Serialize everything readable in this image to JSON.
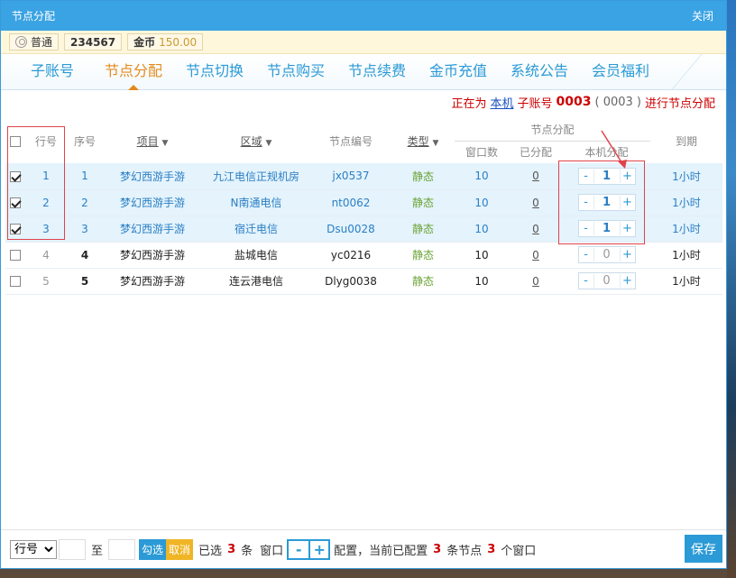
{
  "window": {
    "title": "节点分配",
    "close_label": "关闭"
  },
  "user": {
    "level": "普通",
    "id": "234567",
    "coin_label": "金币",
    "coin_value": "150.00"
  },
  "tabs": [
    {
      "label": "子账号"
    },
    {
      "label": "节点分配"
    },
    {
      "label": "节点切换"
    },
    {
      "label": "节点购买"
    },
    {
      "label": "节点续费"
    },
    {
      "label": "金币充值"
    },
    {
      "label": "系统公告"
    },
    {
      "label": "会员福利"
    }
  ],
  "info": {
    "prefix": "正在为",
    "link": "本机",
    "mid": "子账号",
    "account": "0003",
    "paren": "( 0003 )",
    "suffix": "进行节点分配"
  },
  "table": {
    "headers": {
      "row_no": "行号",
      "seq": "序号",
      "project": "项目",
      "region": "区域",
      "node_id": "节点编号",
      "type": "类型",
      "node_alloc": "节点分配",
      "win_count": "窗口数",
      "allocated": "已分配",
      "local_alloc": "本机分配",
      "expire": "到期"
    },
    "rows": [
      {
        "checked": true,
        "row_no": "1",
        "seq": "1",
        "project": "梦幻西游手游",
        "region": "九江电信正规机房",
        "node_id": "jx0537",
        "type": "静态",
        "win_count": "10",
        "allocated": "0",
        "local": "1",
        "expire": "1小时"
      },
      {
        "checked": true,
        "row_no": "2",
        "seq": "2",
        "project": "梦幻西游手游",
        "region": "N南通电信",
        "node_id": "nt0062",
        "type": "静态",
        "win_count": "10",
        "allocated": "0",
        "local": "1",
        "expire": "1小时"
      },
      {
        "checked": true,
        "row_no": "3",
        "seq": "3",
        "project": "梦幻西游手游",
        "region": "宿迁电信",
        "node_id": "Dsu0028",
        "type": "静态",
        "win_count": "10",
        "allocated": "0",
        "local": "1",
        "expire": "1小时"
      },
      {
        "checked": false,
        "row_no": "4",
        "seq": "4",
        "project": "梦幻西游手游",
        "region": "盐城电信",
        "node_id": "yc0216",
        "type": "静态",
        "win_count": "10",
        "allocated": "0",
        "local": "0",
        "expire": "1小时"
      },
      {
        "checked": false,
        "row_no": "5",
        "seq": "5",
        "project": "梦幻西游手游",
        "region": "连云港电信",
        "node_id": "Dlyg0038",
        "type": "静态",
        "win_count": "10",
        "allocated": "0",
        "local": "0",
        "expire": "1小时"
      }
    ]
  },
  "footer": {
    "select_value": "行号",
    "to_label": "至",
    "check_btn": "勾选",
    "cancel_btn": "取消",
    "selected_label": "已选",
    "selected_count": "3",
    "unit_tiao": "条",
    "window_label": "窗口",
    "config_text": "配置，当前已配置",
    "configured_count": "3",
    "node_text": "条节点",
    "window_count": "3",
    "window_unit": "个窗口",
    "save_label": "保存"
  },
  "colors": {
    "accent": "#2b9ad6",
    "active_tab": "#e48a1c",
    "highlight_row": "#e4f3fc",
    "annotation": "#e0434b"
  }
}
